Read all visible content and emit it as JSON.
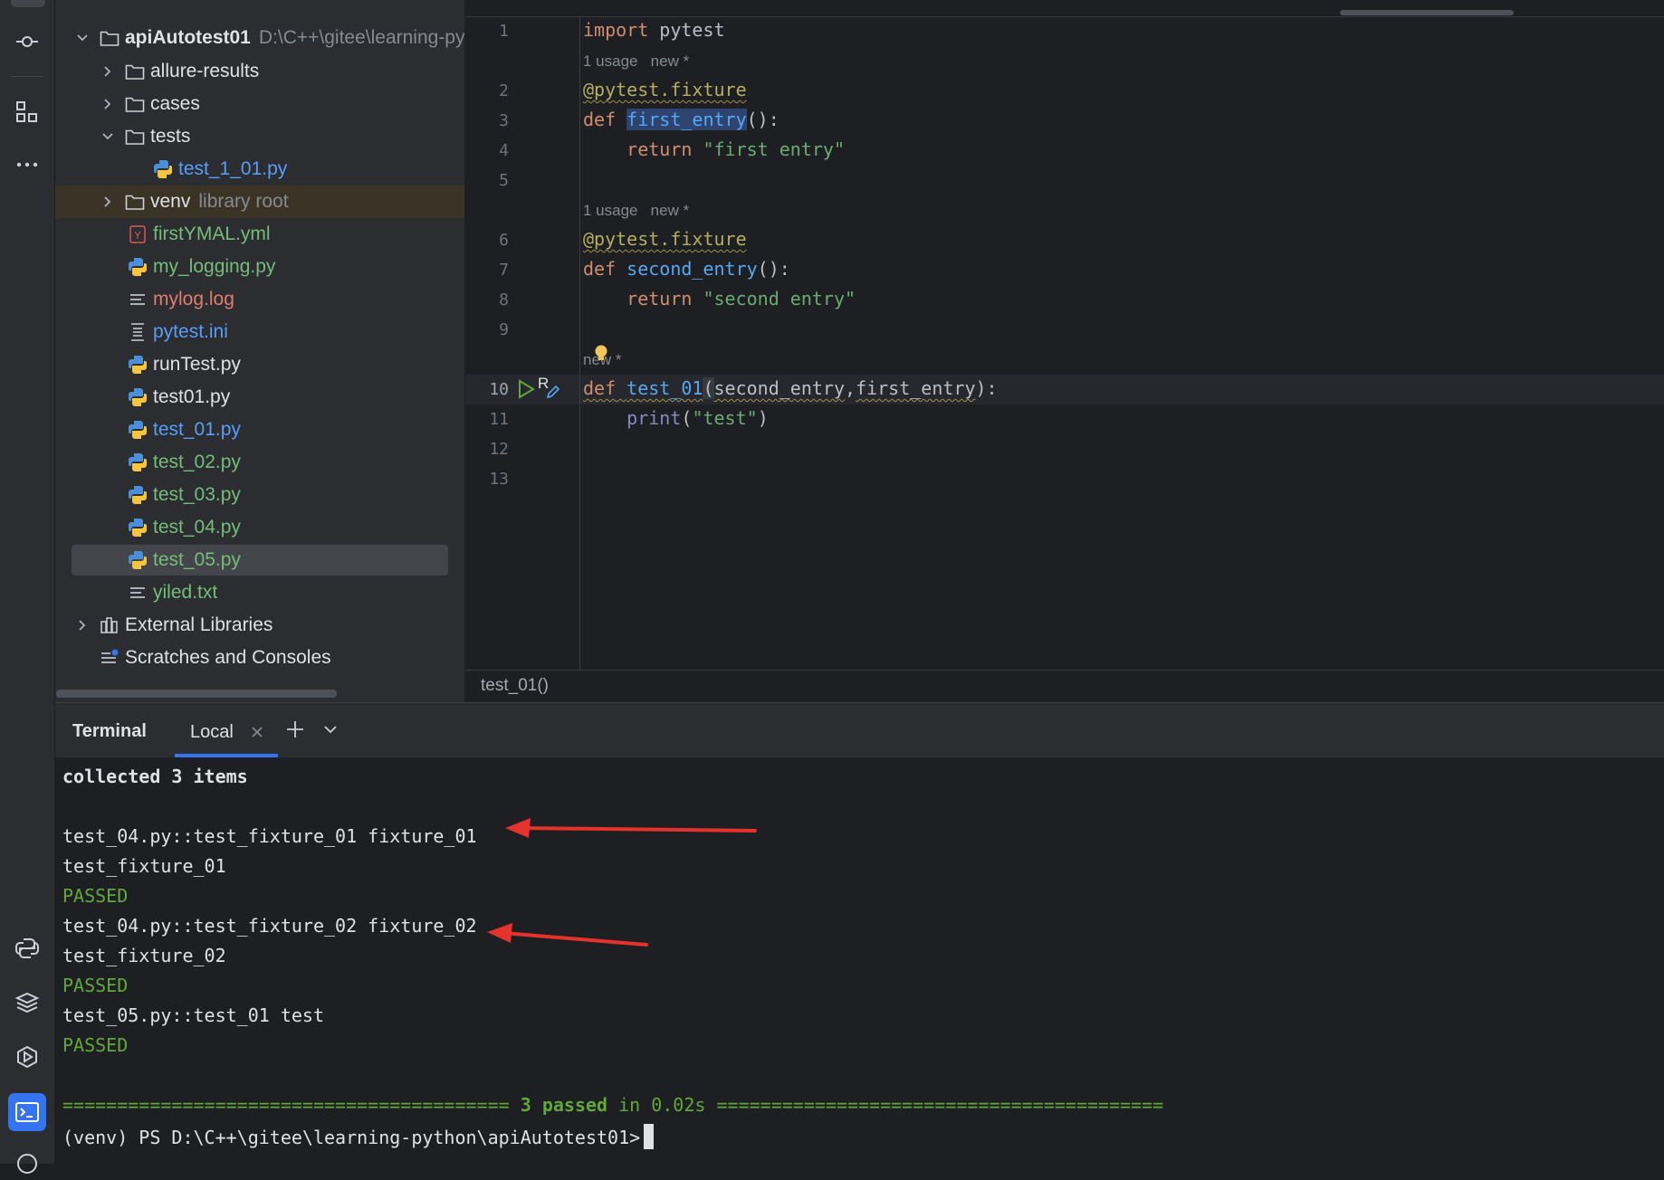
{
  "project": {
    "root_name": "apiAutotest01",
    "root_path": "D:\\C++\\gitee\\learning-py",
    "items": [
      {
        "label": "allure-results"
      },
      {
        "label": "cases"
      },
      {
        "label": "tests"
      },
      {
        "label": "test_1_01.py"
      },
      {
        "label": "venv",
        "suffix": "library root"
      },
      {
        "label": "firstYMAL.yml"
      },
      {
        "label": "my_logging.py"
      },
      {
        "label": "mylog.log"
      },
      {
        "label": "pytest.ini"
      },
      {
        "label": "runTest.py"
      },
      {
        "label": "test01.py"
      },
      {
        "label": "test_01.py"
      },
      {
        "label": "test_02.py"
      },
      {
        "label": "test_03.py"
      },
      {
        "label": "test_04.py"
      },
      {
        "label": "test_05.py"
      },
      {
        "label": "yiled.txt"
      },
      {
        "label": "External Libraries"
      },
      {
        "label": "Scratches and Consoles"
      }
    ]
  },
  "editor": {
    "line_numbers": [
      "1",
      "2",
      "3",
      "4",
      "5",
      "6",
      "7",
      "8",
      "9",
      "10",
      "11",
      "12",
      "13"
    ],
    "inlay_1": {
      "usage": "1 usage",
      "new": "new *"
    },
    "inlay_2": {
      "usage": "1 usage",
      "new": "new *"
    },
    "inlay_3": {
      "new": "new *"
    },
    "code": {
      "l1_kw": "import",
      "l1_rest": " pytest",
      "l2_deco": "@pytest.fixture",
      "l3_kw": "def",
      "l3_fn": "first_entry",
      "l3_rest": "():",
      "l4_kw": "return",
      "l4_str": "\"first entry\"",
      "l6_deco": "@pytest.fixture",
      "l7_kw": "def",
      "l7_fn": "second_entry",
      "l7_rest": "():",
      "l8_kw": "return",
      "l8_str": "\"second entry\"",
      "l10_kw": "def",
      "l10_fn": "test_01",
      "l10_open": "(",
      "l10_p1": "second_entry",
      "l10_comma": ",",
      "l10_p2": "first_entry",
      "l10_close": "):",
      "l11_fn": "print",
      "l11_open": "(",
      "l11_str": "\"test\"",
      "l11_close": ")"
    },
    "gutter_run_letter": "R",
    "breadcrumb": "test_01()"
  },
  "terminal": {
    "title": "Terminal",
    "tab_local": "Local",
    "lines": {
      "collected": "collected 3 items",
      "l1": "test_04.py::test_fixture_01 fixture_01",
      "l2": "test_fixture_01",
      "l3": "PASSED",
      "l4": "test_04.py::test_fixture_02 fixture_02",
      "l5": "test_fixture_02",
      "l6": "PASSED",
      "l7": "test_05.py::test_01 test",
      "l8": "PASSED",
      "summary_left": "========================================= ",
      "summary_passed": "3 passed",
      "summary_mid": " in 0.02s ",
      "summary_right": "=========================================",
      "prompt": "(venv) PS D:\\C++\\gitee\\learning-python\\apiAutotest01>"
    }
  },
  "colors": {
    "annotation_arrow": "#e5322d",
    "passed": "#5fa839",
    "accent": "#3574f0"
  }
}
